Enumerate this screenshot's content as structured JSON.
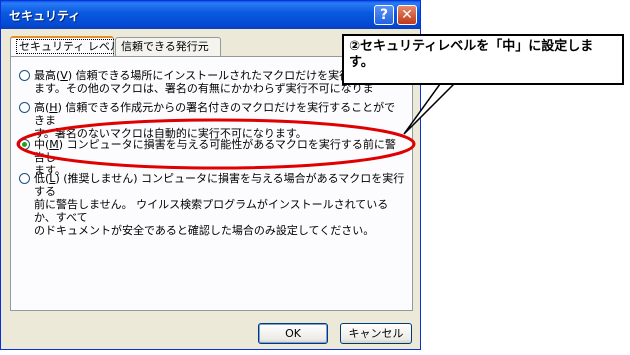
{
  "window": {
    "title": "セキュリティ",
    "help_glyph": "?",
    "close_glyph": "✕"
  },
  "tabs": [
    {
      "label": "セキュリティ レベル",
      "active": true
    },
    {
      "label": "信頼できる発行元",
      "active": false
    }
  ],
  "options": [
    {
      "level": "最高",
      "accel": "V",
      "text": "信頼できる場所にインストールされたマクロだけを実行す",
      "text2": "ます。その他のマクロは、署名の有無にかかわらず実行不可になりま",
      "checked": false
    },
    {
      "level": "高",
      "accel": "H",
      "text": "信頼できる作成元からの署名付きのマクロだけを実行することができま",
      "text2": "す。署名のないマクロは自動的に実行不可になります。",
      "checked": false
    },
    {
      "level": "中",
      "accel": "M",
      "text": "コンピュータに損害を与える可能性があるマクロを実行する前に警告し",
      "text2": "ます。",
      "checked": true
    },
    {
      "level": "低",
      "accel": "L",
      "extra": " (推奨しません)",
      "text": "コンピュータに損害を与える場合があるマクロを実行する",
      "text2": "前に警告しません。 ウイルス検索プログラムがインストールされているか、すべて",
      "text3": "のドキュメントが安全であると確認した場合のみ設定してください。",
      "checked": false
    }
  ],
  "buttons": {
    "ok": "OK",
    "cancel": "キャンセル"
  },
  "callout": {
    "text": "②セキュリティレベルを「中」に設定します。"
  },
  "colors": {
    "highlight": "#e00000",
    "titlebar": "#0a58e8"
  }
}
